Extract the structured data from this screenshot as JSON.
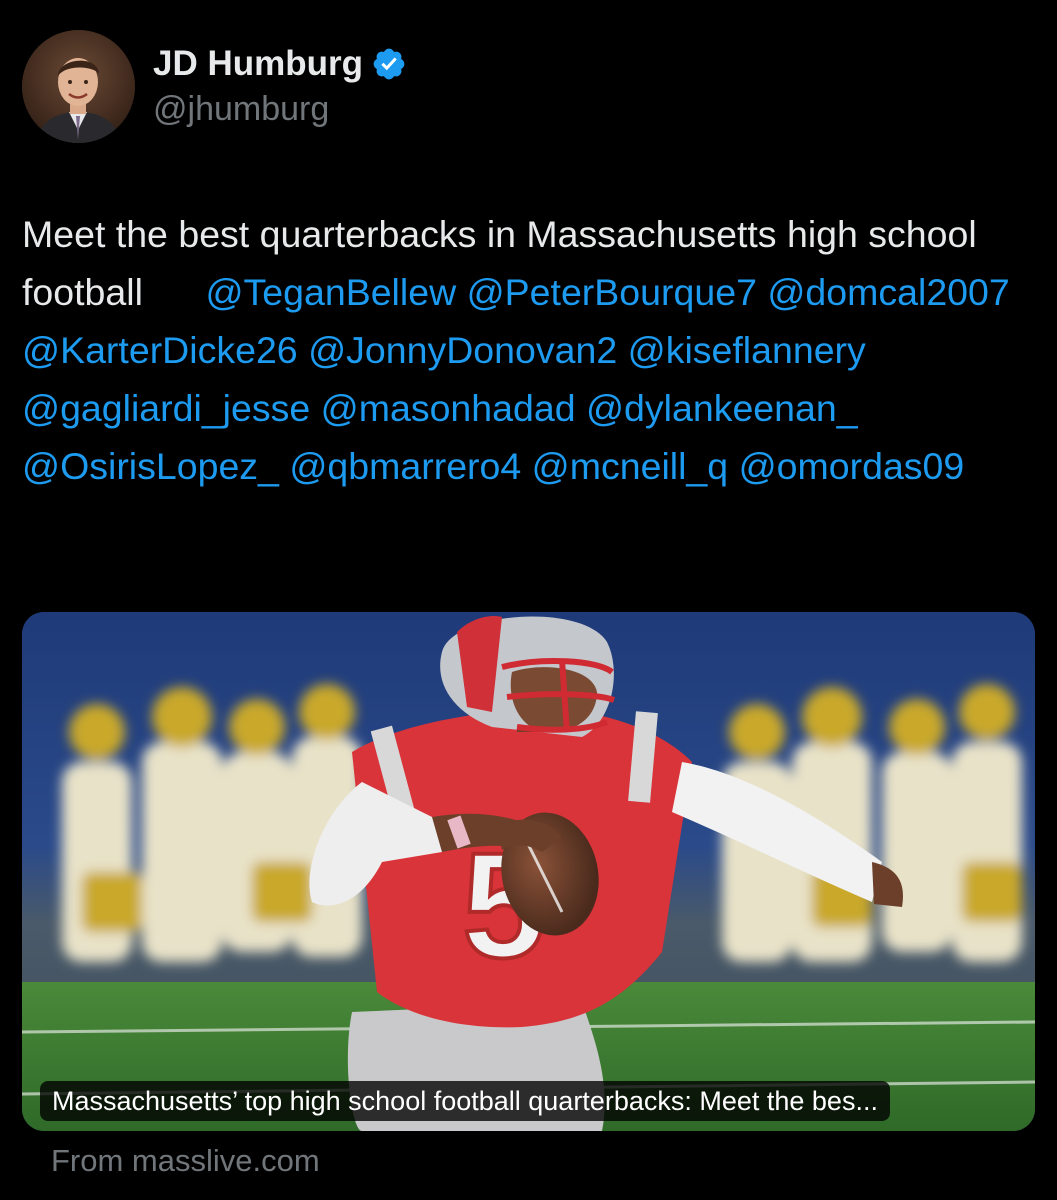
{
  "author": {
    "display_name": "JD Humburg",
    "handle": "@jhumburg",
    "verified": true,
    "verified_color": "#1d9bf0"
  },
  "tweet": {
    "text_prefix": "Meet the best quarterbacks in Massachusetts high school football",
    "mentions": [
      "@TeganBellew",
      "@PeterBourque7",
      "@domcal2007",
      "@KarterDicke26",
      "@JonnyDonovan2",
      "@kiseflannery",
      "@gagliardi_jesse",
      "@masonhadad",
      "@dylankeenan_",
      "@OsirisLopez_",
      "@qbmarrero4",
      "@mcneill_q",
      "@omordas09"
    ]
  },
  "link_card": {
    "caption": "Massachusetts’ top high school football quarterbacks: Meet the bes...",
    "source": "From masslive.com",
    "image_subject": "football-quarterback-photo"
  },
  "colors": {
    "background": "#000000",
    "text": "#e7e9ea",
    "secondary_text": "#71767b",
    "link": "#1d9bf0"
  }
}
